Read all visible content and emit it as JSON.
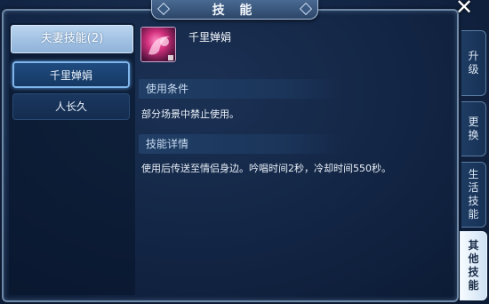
{
  "window": {
    "title": "技 能",
    "close_symbol": "✕"
  },
  "left": {
    "category": "夫妻技能(2)",
    "skills": [
      {
        "label": "千里婵娟",
        "active": true
      },
      {
        "label": "人长久",
        "active": false
      }
    ]
  },
  "detail": {
    "skill_name": "千里婵娟",
    "condition_title": "使用条件",
    "condition_text": "部分场景中禁止使用。",
    "detail_title": "技能详情",
    "detail_text": "使用后传送至情侣身边。吟唱时间2秒，冷却时间550秒。",
    "icon": "heart-moon-icon"
  },
  "tabs": [
    {
      "chars": [
        "升",
        "级"
      ]
    },
    {
      "chars": [
        "更",
        "换"
      ]
    },
    {
      "chars": [
        "生",
        "活",
        "技",
        "能"
      ]
    },
    {
      "chars": [
        "其",
        "他",
        "技",
        "能"
      ],
      "active": true
    }
  ],
  "colors": {
    "accent": "#7fb5ea",
    "panel": "#122443",
    "active_tab": "#f6fbff"
  }
}
